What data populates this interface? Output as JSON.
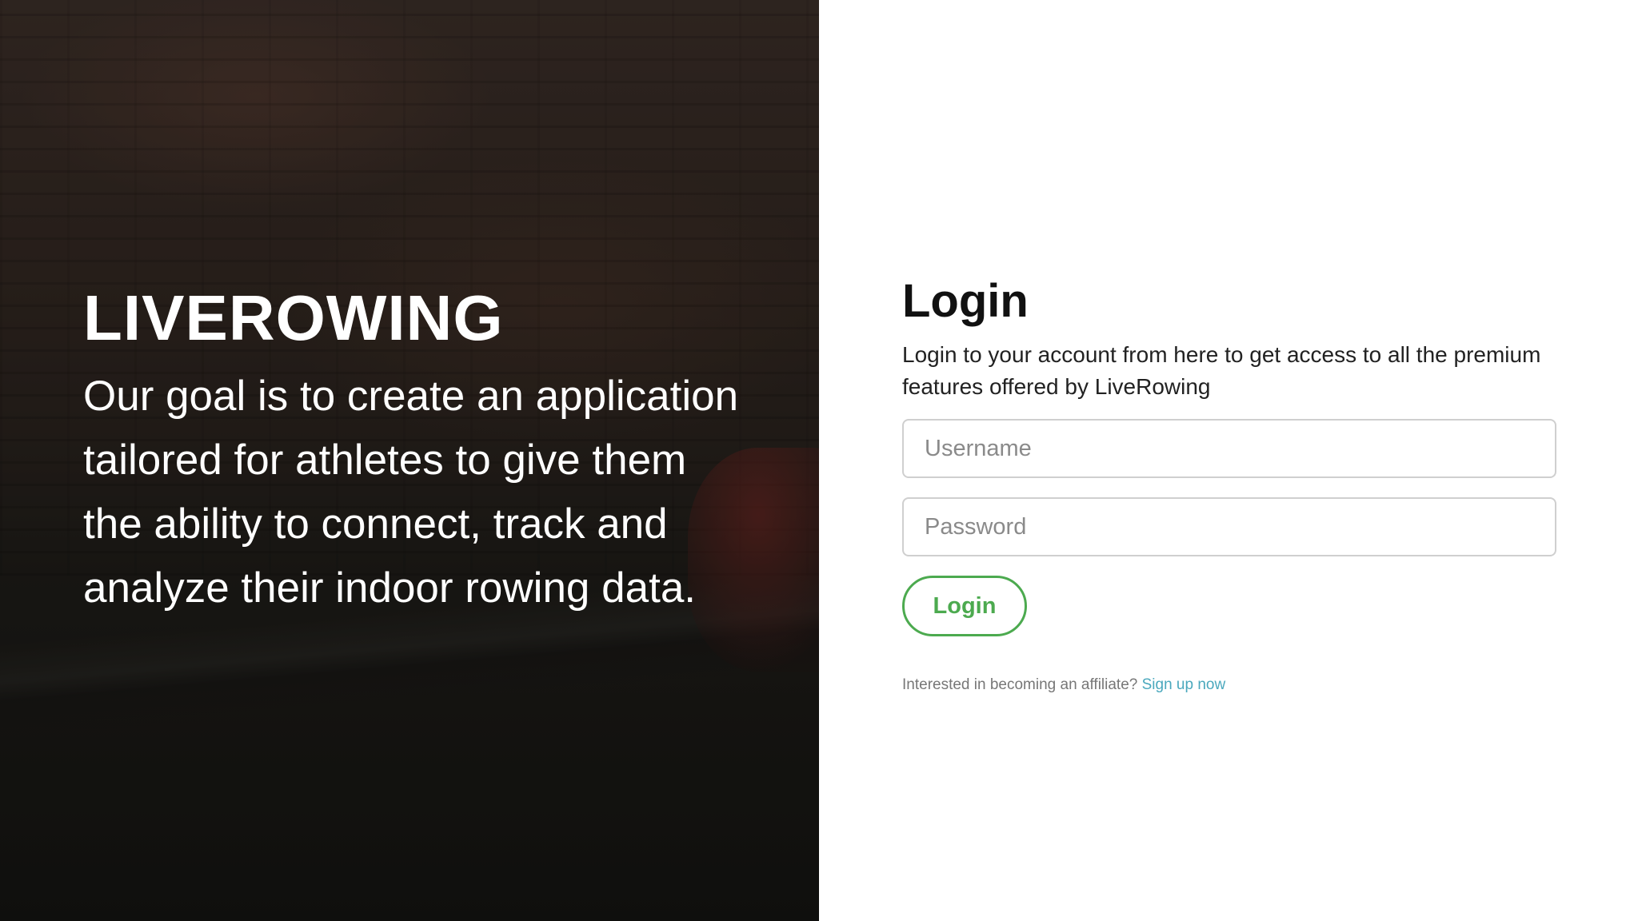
{
  "hero": {
    "title": "LIVEROWING",
    "description": "Our goal is to create an application tailored for athletes to give them the ability to connect, track and analyze their indoor rowing data."
  },
  "login": {
    "title": "Login",
    "description": "Login to your account from here to get access to all the premium features offered by LiveRowing",
    "username_placeholder": "Username",
    "username_value": "",
    "password_placeholder": "Password",
    "password_value": "",
    "submit_label": "Login",
    "affiliate_text": "Interested in becoming an affiliate?",
    "affiliate_link": "Sign up now"
  },
  "colors": {
    "accent_green": "#4caa4f",
    "link_teal": "#4aa8bd",
    "panel_background": "#ffffff"
  }
}
